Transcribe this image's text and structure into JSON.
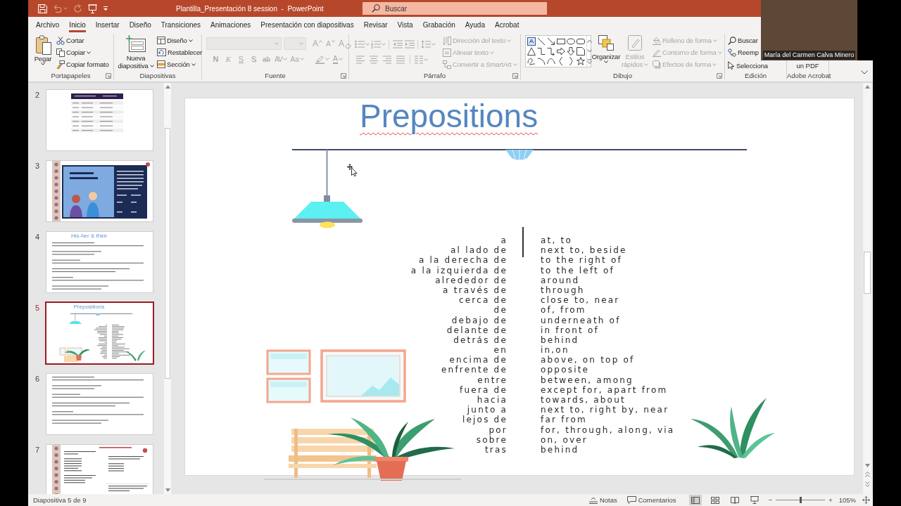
{
  "window": {
    "title": "Plantilla_Presentación 8 session  -  PowerPoint",
    "search": {
      "placeholder": "Buscar"
    }
  },
  "quick_access": [
    {
      "kind": "save",
      "disabled": false
    },
    {
      "kind": "undo",
      "disabled": true
    },
    {
      "kind": "redo",
      "disabled": true
    },
    {
      "kind": "present",
      "disabled": false
    },
    {
      "kind": "customize",
      "disabled": false
    }
  ],
  "tabs": [
    {
      "label": "Archivo",
      "selected": false
    },
    {
      "label": "Inicio",
      "selected": true
    },
    {
      "label": "Insertar",
      "selected": false
    },
    {
      "label": "Diseño",
      "selected": false
    },
    {
      "label": "Transiciones",
      "selected": false
    },
    {
      "label": "Animaciones",
      "selected": false
    },
    {
      "label": "Presentación con diapositivas",
      "selected": false
    },
    {
      "label": "Revisar",
      "selected": false
    },
    {
      "label": "Vista",
      "selected": false
    },
    {
      "label": "Grabación",
      "selected": false
    },
    {
      "label": "Ayuda",
      "selected": false
    },
    {
      "label": "Acrobat",
      "selected": false
    }
  ],
  "ribbon": {
    "clipboard": {
      "label": "Portapapeles",
      "launcher": true,
      "paste": {
        "label": "Pegar",
        "dropdown": true
      },
      "actions": [
        {
          "kind": "cut",
          "label": "Cortar",
          "dropdown": false
        },
        {
          "kind": "copy",
          "label": "Copiar",
          "dropdown": true
        },
        {
          "kind": "format_painter",
          "label": "Copiar formato",
          "dropdown": false
        }
      ]
    },
    "slides": {
      "label": "Diapositivas",
      "launcher": false,
      "new_slide": {
        "label": "Nueva diapositiva",
        "dropdown": true
      },
      "actions": [
        {
          "kind": "layout",
          "label": "Diseño",
          "dropdown": true
        },
        {
          "kind": "reset",
          "label": "Restablecer",
          "dropdown": false
        },
        {
          "kind": "section",
          "label": "Sección",
          "dropdown": true
        }
      ]
    },
    "font": {
      "label": "Fuente",
      "launcher": true,
      "disabled": true,
      "size_buttons": [
        {
          "kind": "grow",
          "label": "A"
        },
        {
          "kind": "shrink",
          "label": "A"
        },
        {
          "kind": "clear",
          "label": "A"
        }
      ],
      "format_buttons": [
        {
          "kind": "bold",
          "label": "N",
          "dropdown": false
        },
        {
          "kind": "italic",
          "label": "K",
          "dropdown": false
        },
        {
          "kind": "underline",
          "label": "S",
          "dropdown": false
        },
        {
          "kind": "shadow",
          "label": "S",
          "dropdown": false
        },
        {
          "kind": "strike",
          "label": "ab",
          "dropdown": false
        },
        {
          "kind": "spacing",
          "label": "AV",
          "dropdown": true
        },
        {
          "kind": "case",
          "label": "Aa",
          "dropdown": true
        },
        {
          "kind": "highlight",
          "dropdown": true
        },
        {
          "kind": "color",
          "label": "A",
          "dropdown": true
        }
      ]
    },
    "paragraph": {
      "label": "Párrafo",
      "launcher": true,
      "disabled": true,
      "actions": [
        {
          "kind": "direction",
          "label": "Dirección del texto",
          "dropdown": true
        },
        {
          "kind": "align",
          "label": "Alinear texto",
          "dropdown": true
        },
        {
          "kind": "smartart",
          "label": "Convertir a SmartArt",
          "dropdown": true
        }
      ]
    },
    "drawing": {
      "label": "Dibujo",
      "launcher": true,
      "arrange": {
        "label": "Organizar",
        "disabled": false,
        "dropdown": true
      },
      "quick_styles": {
        "label": "Estilos rápidos",
        "disabled": true,
        "dropdown": true
      },
      "actions": [
        {
          "kind": "fill",
          "label": "Relleno de forma",
          "disabled": true,
          "dropdown": true
        },
        {
          "kind": "outline",
          "label": "Contorno de forma",
          "disabled": true,
          "dropdown": true
        },
        {
          "kind": "effects",
          "label": "Efectos de forma",
          "disabled": true,
          "dropdown": true
        }
      ]
    },
    "editing": {
      "label": "Edición",
      "launcher": false,
      "actions": [
        {
          "kind": "find",
          "label": "Buscar"
        },
        {
          "kind": "replace",
          "label": "Reemp"
        },
        {
          "kind": "select",
          "label": "Selecciona"
        }
      ]
    },
    "acrobat": {
      "label": "Adobe Acrobat",
      "launcher": false,
      "action": "un PDF"
    }
  },
  "slides_pane": {
    "slides": [
      {
        "number": "2",
        "selected": false,
        "kind": "table"
      },
      {
        "number": "3",
        "selected": false,
        "kind": "picture"
      },
      {
        "number": "4",
        "selected": false,
        "kind": "text",
        "title": "His-her & their"
      },
      {
        "number": "5",
        "selected": true,
        "kind": "prepositions",
        "title": "Prepositions"
      },
      {
        "number": "6",
        "selected": false,
        "kind": "text"
      },
      {
        "number": "7",
        "selected": false,
        "kind": "columns"
      }
    ]
  },
  "slide": {
    "title": {
      "text": "Prepositions",
      "spelling_error": true
    },
    "rows": [
      {
        "spanish": "a",
        "english": "at, to"
      },
      {
        "spanish": "al lado de",
        "english": "next to, beside"
      },
      {
        "spanish": "a la derecha de",
        "english": "to the right of"
      },
      {
        "spanish": "a la izquierda de",
        "english": "to the left of"
      },
      {
        "spanish": "alrededor de",
        "english": "around"
      },
      {
        "spanish": "a través de",
        "english": "through"
      },
      {
        "spanish": "cerca de",
        "english": "close to, near"
      },
      {
        "spanish": "de",
        "english": "of, from"
      },
      {
        "spanish": "debajo de",
        "english": "underneath of"
      },
      {
        "spanish": "delante de",
        "english": "in front of"
      },
      {
        "spanish": "detrás de",
        "english": "behind"
      },
      {
        "spanish": "en",
        "english": "in,on"
      },
      {
        "spanish": "encima de",
        "english": "above, on top of"
      },
      {
        "spanish": "enfrente de",
        "english": "opposite"
      },
      {
        "spanish": "entre",
        "english": "between, among"
      },
      {
        "spanish": "fuera de",
        "english": "except for, apart from"
      },
      {
        "spanish": "hacia",
        "english": "towards, about"
      },
      {
        "spanish": "junto a",
        "english": "next to, right by, near"
      },
      {
        "spanish": "lejos de",
        "english": "far from"
      },
      {
        "spanish": "por",
        "english": "for, through, along, via"
      },
      {
        "spanish": "sobre",
        "english": "on, over"
      },
      {
        "spanish": "tras",
        "english": "behind"
      }
    ]
  },
  "status_bar": {
    "slide_position": "Diapositiva 5 de 9",
    "notes": "Notas",
    "comments": "Comentarios",
    "views": [
      {
        "kind": "normal",
        "selected": true
      },
      {
        "kind": "sorter",
        "selected": false
      },
      {
        "kind": "reading",
        "selected": false
      },
      {
        "kind": "slideshow",
        "selected": false
      }
    ],
    "zoom": {
      "minus": "−",
      "plus": "+",
      "level": 0.5,
      "reading": "105%"
    }
  },
  "video_call": {
    "participant": "María del Carmen Calva Minero"
  }
}
